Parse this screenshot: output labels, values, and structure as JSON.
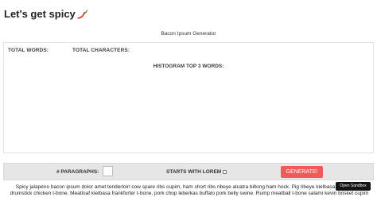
{
  "header": {
    "title": "Let's get spicy",
    "title_icon": "chili-pepper-icon",
    "subtitle": "Bacon Ipsum Generator"
  },
  "stats": {
    "total_words_label": "TOTAL WORDS:",
    "total_characters_label": "TOTAL CHARACTERS:",
    "histogram_label": "HISTOGRAM TOP 3 WORDS:"
  },
  "controls": {
    "paragraphs_label": "# PARAGRAPHS:",
    "paragraphs_value": "",
    "starts_with_lorem_label": "STARTS WITH LOREM",
    "starts_with_lorem_checked": false,
    "generate_label": "GENERATE!"
  },
  "output": {
    "text": "Spicy jalapeno bacon ipsum dolor amet tenderloin cow spare ribs cupim, ham short ribs ribeye alcatra biltong ham hock. Pig ribeye kielbasa tri-tip, kevin drumstick chicken t-bone. Meatloaf kielbasa frankfurter t-bone, pork chop leberkas buffalo pork belly swine. Rump meatball t-bone salami kevin brisket cupim"
  },
  "sandbox": {
    "label": "Open Sandbox"
  },
  "colors": {
    "generate_button": "#f15a5a",
    "controls_background": "#e6e6e6",
    "sandbox_button": "#151515"
  }
}
